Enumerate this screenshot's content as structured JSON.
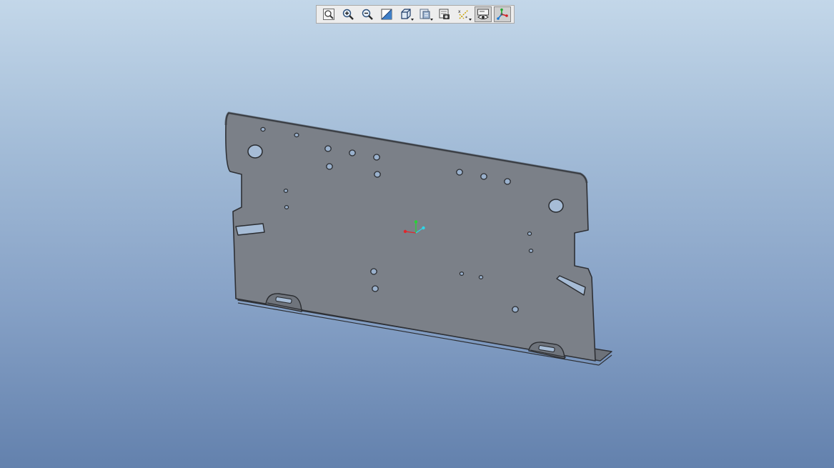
{
  "toolbar": {
    "buttons": [
      {
        "icon": "refit-icon",
        "active": false,
        "has_dropdown": false
      },
      {
        "icon": "zoom-in-icon",
        "active": false,
        "has_dropdown": false
      },
      {
        "icon": "zoom-out-icon",
        "active": false,
        "has_dropdown": false
      },
      {
        "icon": "repaint-icon",
        "active": false,
        "has_dropdown": false
      },
      {
        "icon": "display-style-icon",
        "active": false,
        "has_dropdown": true
      },
      {
        "icon": "saved-orientations-icon",
        "active": false,
        "has_dropdown": true
      },
      {
        "icon": "view-manager-icon",
        "active": false,
        "has_dropdown": false
      },
      {
        "icon": "datum-display-icon",
        "active": false,
        "has_dropdown": true
      },
      {
        "icon": "annotation-display-icon",
        "active": true,
        "has_dropdown": false
      },
      {
        "icon": "spin-center-icon",
        "active": true,
        "has_dropdown": false
      }
    ]
  },
  "colors": {
    "background_top": "#c3d7e9",
    "background_bottom": "#6381ad",
    "part_face": "#7b8088",
    "part_edge": "#2e3035",
    "axis_x": "#e0262b",
    "axis_y": "#27d436",
    "axis_z": "#2ed6e8"
  }
}
